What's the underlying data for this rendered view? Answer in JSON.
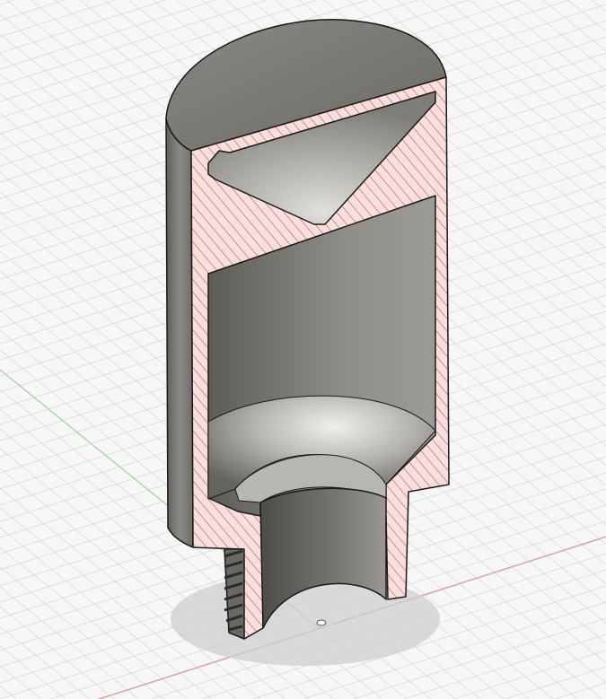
{
  "viewport": {
    "view": "section-analysis",
    "colors": {
      "background": "#f7f7f7",
      "grid": "#d6d6d6",
      "x_axis": "#e88a8a",
      "y_axis": "#7fd37f",
      "section_fill": "#fbdede",
      "section_hatch": "#c0392b",
      "body": "#7d7b74",
      "cavity": "#8f8c86"
    }
  }
}
